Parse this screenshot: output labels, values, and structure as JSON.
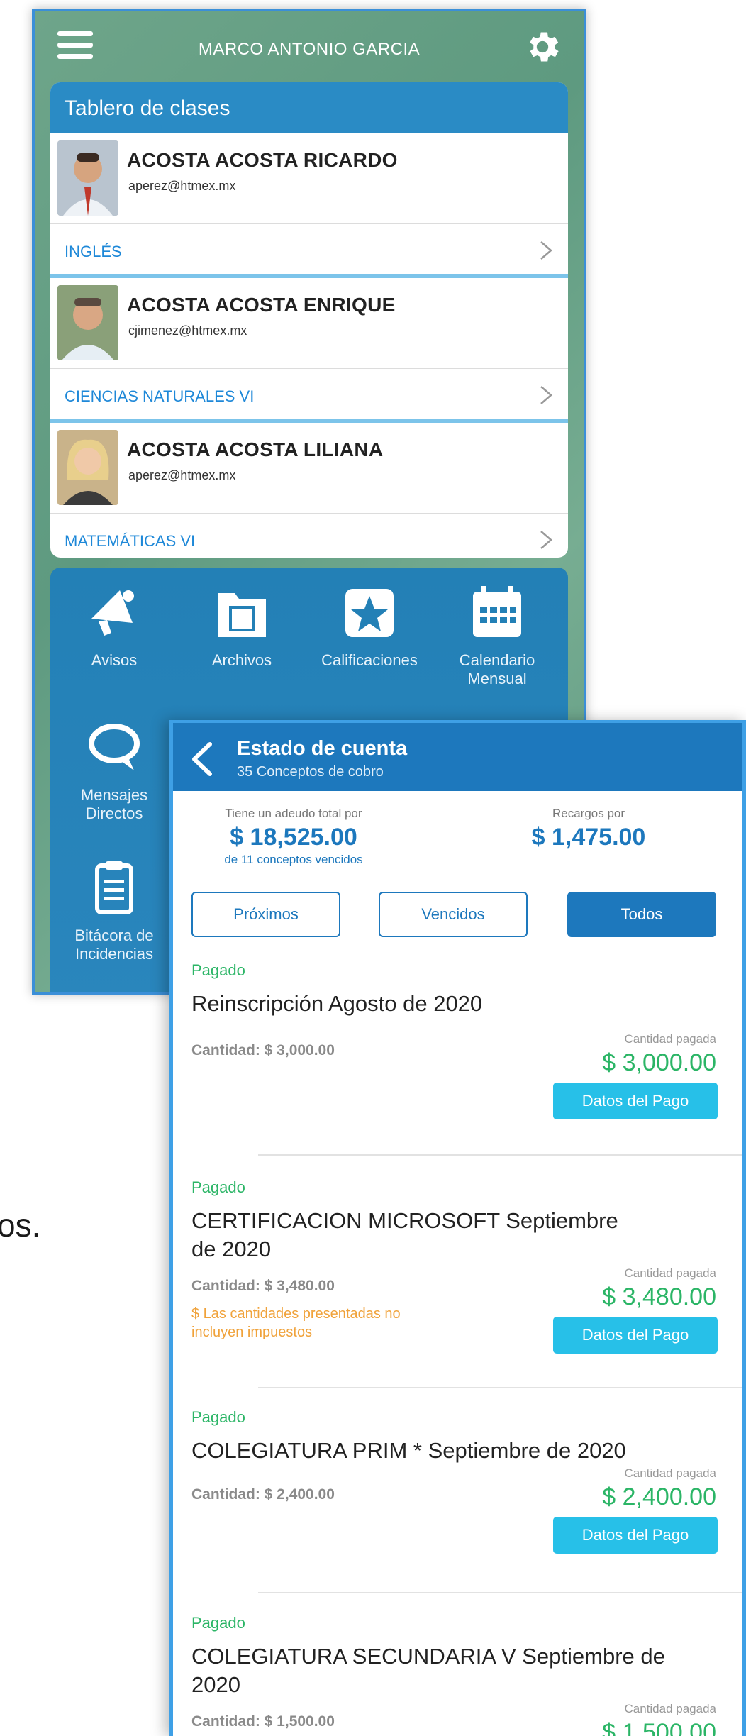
{
  "dashboard": {
    "user_name": "MARCO ANTONIO GARCIA",
    "board_title": "Tablero de clases",
    "teachers": [
      {
        "name": "ACOSTA ACOSTA RICARDO",
        "email": "aperez@htmex.mx",
        "subject": "INGLÉS"
      },
      {
        "name": "ACOSTA ACOSTA ENRIQUE",
        "email": "cjimenez@htmex.mx",
        "subject": "CIENCIAS NATURALES VI"
      },
      {
        "name": "ACOSTA ACOSTA LILIANA",
        "email": "aperez@htmex.mx",
        "subject": "MATEMÁTICAS VI"
      }
    ],
    "tiles": [
      {
        "label": "Avisos",
        "icon": "megaphone-icon"
      },
      {
        "label": "Archivos",
        "icon": "folder-icon"
      },
      {
        "label": "Calificaciones",
        "icon": "star-icon"
      },
      {
        "label": "Calendario\nMensual",
        "icon": "calendar-icon"
      },
      {
        "label": "Mensajes\nDirectos",
        "icon": "chat-icon"
      },
      {
        "label": "Bitácora de\nIncidencias",
        "icon": "clipboard-icon"
      }
    ]
  },
  "account": {
    "title": "Estado de cuenta",
    "subtitle": "35 Conceptos de cobro",
    "debt_label": "Tiene un adeudo total por",
    "debt_amount": "$ 18,525.00",
    "debt_sub": "de 11 conceptos vencidos",
    "surcharge_label": "Recargos por",
    "surcharge_amount": "$ 1,475.00",
    "filters": [
      "Próximos",
      "Vencidos",
      "Todos"
    ],
    "active_filter": "Todos",
    "paid_label": "Cantidad pagada",
    "pay_button": "Datos del Pago",
    "items": [
      {
        "status": "Pagado",
        "concept": "Reinscripción Agosto de 2020",
        "qty": "Cantidad:  $ 3,000.00",
        "paid": "$ 3,000.00",
        "note": ""
      },
      {
        "status": "Pagado",
        "concept": "CERTIFICACION MICROSOFT Septiembre de 2020",
        "qty": "Cantidad:  $ 3,480.00",
        "paid": "$ 3,480.00",
        "note": "$ Las cantidades presentadas no incluyen impuestos"
      },
      {
        "status": "Pagado",
        "concept": "COLEGIATURA PRIM * Septiembre de 2020",
        "qty": "Cantidad:  $ 2,400.00",
        "paid": "$ 2,400.00",
        "note": ""
      },
      {
        "status": "Pagado",
        "concept": "COLEGIATURA SECUNDARIA V Septiembre de 2020",
        "qty": "Cantidad:  $ 1,500.00",
        "paid": "$ 1,500.00",
        "note": ""
      }
    ]
  },
  "fragment_text": "os."
}
